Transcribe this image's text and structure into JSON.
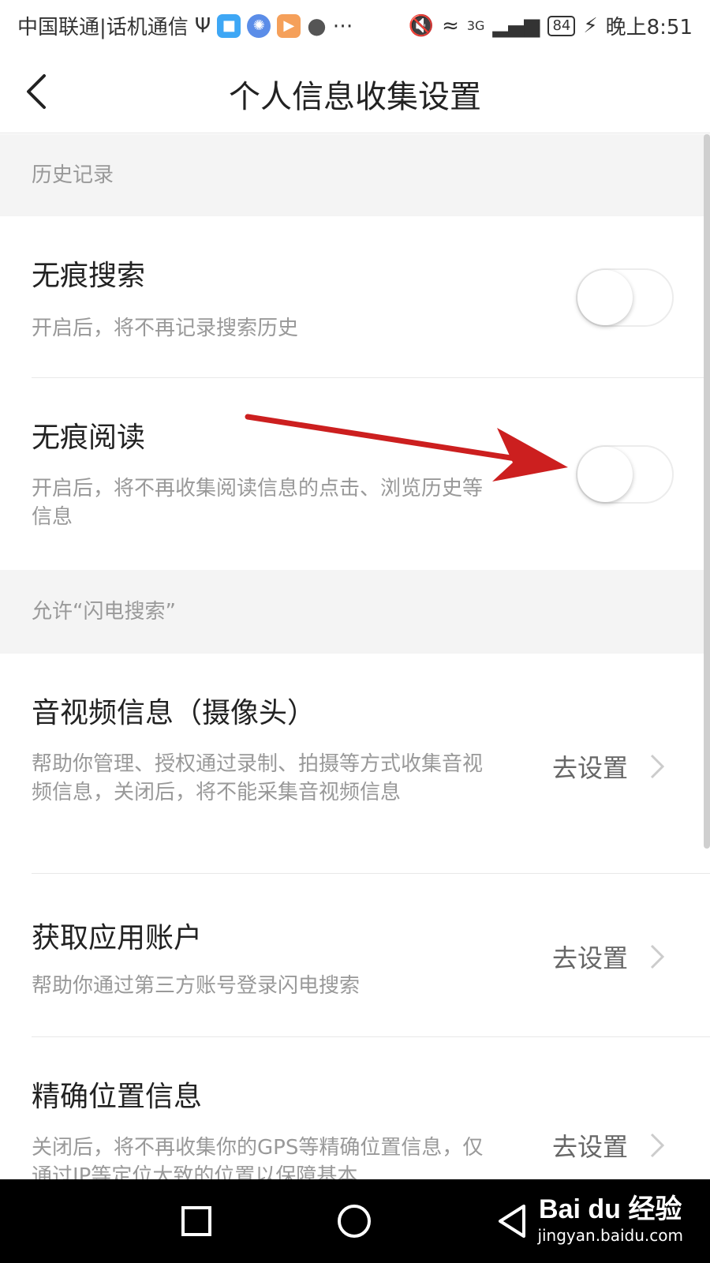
{
  "status_bar": {
    "carrier": "中国联通|话机通信",
    "battery": "84",
    "network": "3G",
    "time": "晚上8:51"
  },
  "header": {
    "title": "个人信息收集设置"
  },
  "sections": {
    "history": {
      "label": "历史记录",
      "items": [
        {
          "title": "无痕搜索",
          "desc": "开启后，将不再记录搜索历史",
          "enabled": false
        },
        {
          "title": "无痕阅读",
          "desc": "开启后，将不再收集阅读信息的点击、浏览历史等信息",
          "enabled": false
        }
      ]
    },
    "permissions": {
      "label": "允许“闪电搜索”",
      "items": [
        {
          "title": "音视频信息（摄像头）",
          "desc": "帮助你管理、授权通过录制、拍摄等方式收集音视频信息，关闭后，将不能采集音视频信息",
          "action": "去设置"
        },
        {
          "title": "获取应用账户",
          "desc": "帮助你通过第三方账号登录闪电搜索",
          "action": "去设置"
        },
        {
          "title": "精确位置信息",
          "desc": "关闭后，将不再收集你的GPS等精确位置信息，仅通过IP等定位大致的位置以保障基本",
          "action": "去设置"
        }
      ]
    }
  },
  "watermark": {
    "logo": "Bai du 经验",
    "url": "jingyan.baidu.com"
  },
  "colors": {
    "annotation_arrow": "#cc1f1f",
    "section_bg": "#f4f4f4",
    "muted_text": "#999999"
  }
}
